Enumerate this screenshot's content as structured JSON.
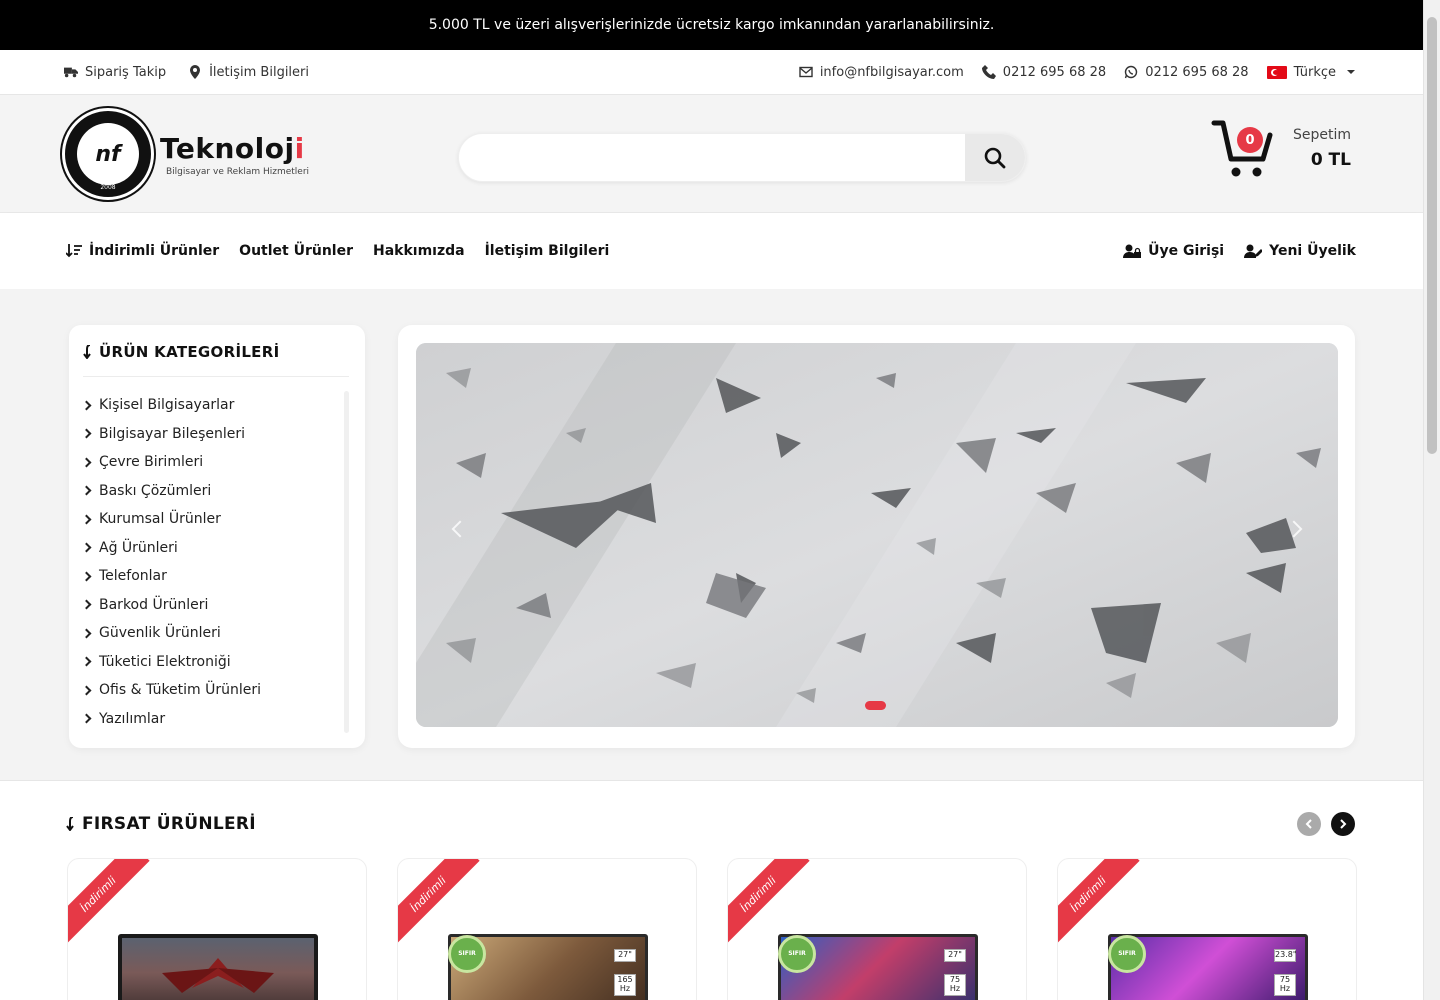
{
  "announcement": "5.000 TL ve üzeri alışverişlerinizde ücretsiz kargo imkanından yararlanabilirsiniz.",
  "infobar": {
    "order_tracking": "Sipariş Takip",
    "contact_info": "İletişim Bilgileri",
    "email": "info@nfbilgisayar.com",
    "phone": "0212 695 68 28",
    "whatsapp": "0212 695 68 28",
    "language": "Türkçe"
  },
  "logo": {
    "mark": "nf",
    "year": "2008",
    "name_main": "Teknoloj",
    "name_accent": "i",
    "tagline": "Bilgisayar ve Reklam Hizmetleri"
  },
  "search": {
    "placeholder": "",
    "icon": "search-icon"
  },
  "cart": {
    "count": "0",
    "label": "Sepetim",
    "amount": "0 TL"
  },
  "nav": {
    "items": [
      "İndirimli Ürünler",
      "Outlet Ürünler",
      "Hakkımızda",
      "İletişim Bilgileri"
    ],
    "login": "Üye Girişi",
    "register": "Yeni Üyelik"
  },
  "categories": {
    "title": "ÜRÜN KATEGORİLERİ",
    "items": [
      "Kişisel Bilgisayarlar",
      "Bilgisayar Bileşenleri",
      "Çevre Birimleri",
      "Baskı Çözümleri",
      "Kurumsal Ürünler",
      "Ağ Ürünleri",
      "Telefonlar",
      "Barkod Ürünleri",
      "Güvenlik Ürünleri",
      "Tüketici Elektroniği",
      "Ofis & Tüketim Ürünleri",
      "Yazılımlar"
    ]
  },
  "deals": {
    "title": "FIRSAT ÜRÜNLERİ",
    "badge": "İndirimli",
    "products": [
      {
        "seal": "",
        "size": "",
        "hz": ""
      },
      {
        "seal": "SIFIR",
        "size": "27\"",
        "hz": "165 Hz"
      },
      {
        "seal": "SIFIR",
        "size": "27\"",
        "hz": "75 Hz"
      },
      {
        "seal": "SIFIR",
        "size": "23.8\"",
        "hz": "75 Hz"
      }
    ]
  },
  "colors": {
    "accent": "#e63946",
    "topbar": "#000000"
  }
}
